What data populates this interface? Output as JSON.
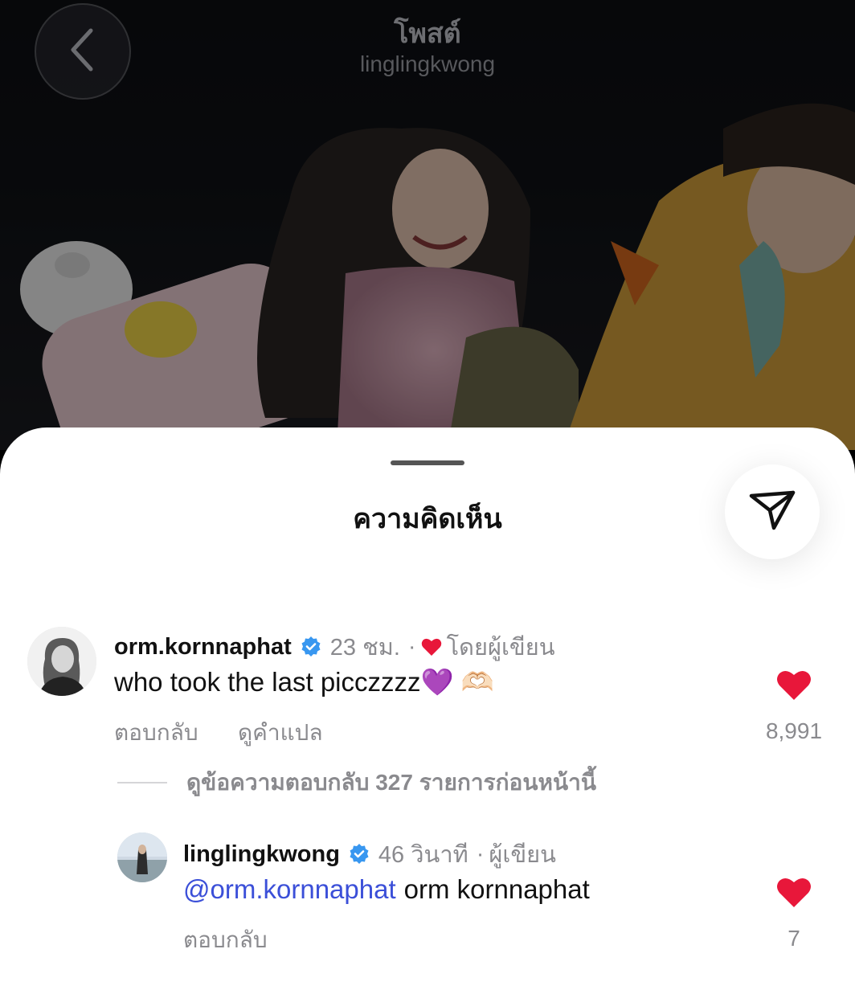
{
  "header": {
    "title": "โพสต์",
    "subtitle": "linglingkwong"
  },
  "sheet": {
    "title": "ความคิดเห็น"
  },
  "comments": [
    {
      "username": "orm.kornnaphat",
      "time": "23 ชม.",
      "separator": "·",
      "liked_by_author_label": "โดยผู้เขียน",
      "text": "who took the last picczzzz💜 🫶🏻",
      "reply_label": "ตอบกลับ",
      "translate_label": "ดูคำแปล",
      "likes": "8,991",
      "view_replies_label": "ดูข้อความตอบกลับ 327 รายการก่อนหน้านี้"
    },
    {
      "username": "linglingkwong",
      "time": "46 วินาที",
      "separator": "·",
      "author_label": "ผู้เขียน",
      "mention": "@orm.kornnaphat",
      "text": "orm kornnaphat",
      "reply_label": "ตอบกลับ",
      "likes": "7"
    }
  ],
  "icons": {
    "back": "chevron-left-icon",
    "share": "send-icon",
    "verified": "verified-badge-icon",
    "heart": "heart-icon"
  },
  "colors": {
    "like_red": "#e8173a",
    "verified_blue": "#3897f0",
    "mention_blue": "#3b4fd8",
    "muted_text": "#8a8a8e"
  }
}
